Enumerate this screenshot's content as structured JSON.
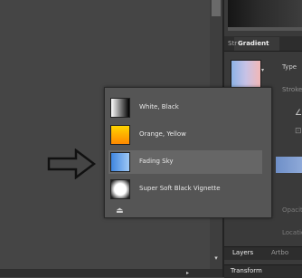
{
  "panel": {
    "tabs": [
      {
        "label": "Str"
      },
      {
        "label": "Gradient"
      }
    ],
    "type_label": "Type",
    "stroke_label": "Stroke",
    "faded_labels": [
      "Opacity",
      "Location"
    ]
  },
  "presets": [
    {
      "label": "White, Black",
      "swatch": "white-black"
    },
    {
      "label": "Orange, Yellow",
      "swatch": "orange-yellow"
    },
    {
      "label": "Fading Sky",
      "swatch": "fading-sky",
      "selected": true
    },
    {
      "label": "Super Soft Black Vignette",
      "swatch": "vignette"
    }
  ],
  "bottom_tabs": {
    "layers": "Layers",
    "artboards": "Artbo",
    "transform": "Transform"
  },
  "icons": {
    "footer": "save-preset-icon",
    "pointer": "arrow-outline-icon"
  },
  "colors": {
    "panel_bg": "#3a3a3a",
    "canvas_bg": "#454545",
    "popup_bg": "#555555"
  }
}
